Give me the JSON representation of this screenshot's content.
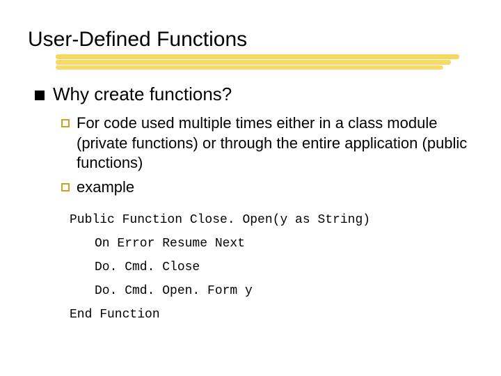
{
  "title": "User-Defined Functions",
  "section": {
    "heading": "Why create functions?",
    "items": [
      "For code used multiple times either in a class module (private functions) or through the entire application (public functions)",
      "example"
    ]
  },
  "code": {
    "lines": [
      "Public Function Close. Open(y as String)",
      "On Error Resume Next",
      "Do. Cmd. Close",
      "Do. Cmd. Open. Form y",
      "End Function"
    ]
  }
}
